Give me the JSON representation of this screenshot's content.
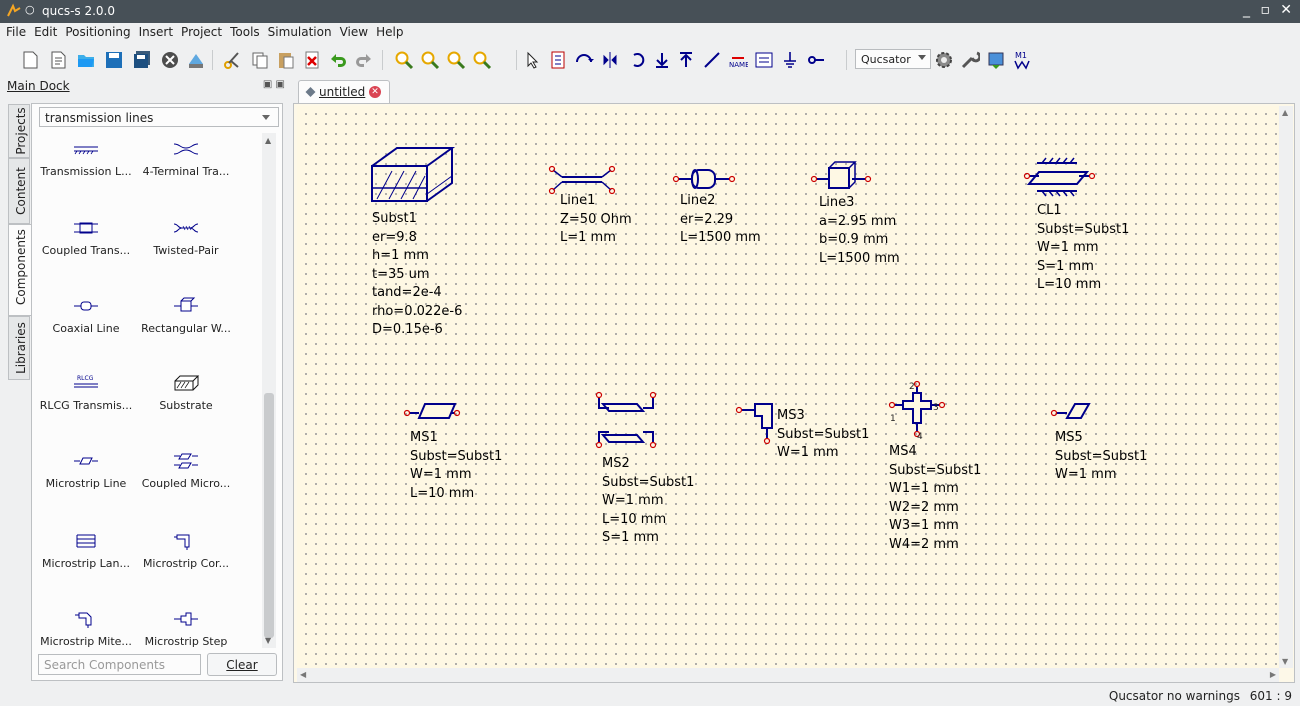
{
  "window": {
    "title": "qucs-s 2.0.0",
    "controls": [
      "_",
      "▫",
      "✕"
    ]
  },
  "menu": [
    "File",
    "Edit",
    "Positioning",
    "Insert",
    "Project",
    "Tools",
    "Simulation",
    "View",
    "Help"
  ],
  "toolbar": {
    "simulator": "Qucsator"
  },
  "dock": {
    "title": "Main Dock",
    "tabs": [
      "Projects",
      "Content",
      "Components",
      "Libraries"
    ],
    "category": "transmission lines",
    "components": [
      "Transmission L...",
      "4-Terminal Tra...",
      "Coupled Trans...",
      "Twisted-Pair",
      "Coaxial Line",
      "Rectangular W...",
      "RLCG Transmis...",
      "Substrate",
      "Microstrip Line",
      "Coupled Micro...",
      "Microstrip Lan...",
      "Microstrip Cor...",
      "Microstrip Mite...",
      "Microstrip Step"
    ],
    "search_placeholder": "Search Components",
    "clear_label": "Clear"
  },
  "doc_tab": {
    "label": "untitled"
  },
  "schematic": {
    "subst1": "Subst1\ner=9.8\nh=1 mm\nt=35 um\ntand=2e-4\nrho=0.022e-6\nD=0.15e-6",
    "line1": "Line1\nZ=50 Ohm\nL=1 mm",
    "line2": "Line2\ner=2.29\nL=1500 mm",
    "line3": "Line3\na=2.95 mm\nb=0.9 mm\nL=1500 mm",
    "cl1": "CL1\nSubst=Subst1\nW=1 mm\nS=1 mm\nL=10 mm",
    "ms1": "MS1\nSubst=Subst1\nW=1 mm\nL=10 mm",
    "ms2": "MS2\nSubst=Subst1\nW=1 mm\nL=10 mm\nS=1 mm",
    "ms3": "MS3\nSubst=Subst1\nW=1 mm",
    "ms4": "MS4\nSubst=Subst1\nW1=1 mm\nW2=2 mm\nW3=1 mm\nW4=2 mm",
    "ms5": "MS5\nSubst=Subst1\nW=1 mm",
    "ms4_pins": [
      "1",
      "2",
      "3",
      "4"
    ]
  },
  "status": {
    "message": "Qucsator  no warnings",
    "position": "601 : 9"
  },
  "colors": {
    "wire": "#00008b",
    "port": "#cc0000",
    "canvas": "#fef8e4",
    "titlebar": "#475057"
  }
}
